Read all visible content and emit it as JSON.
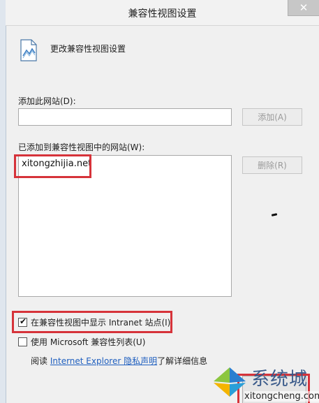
{
  "window": {
    "title": "兼容性视图设置",
    "close_glyph": "✕"
  },
  "header": {
    "icon": "compatibility-document-icon",
    "text": "更改兼容性视图设置"
  },
  "add_site": {
    "label": "添加此网站(D):",
    "value": "",
    "add_button": "添加(A)"
  },
  "added_sites": {
    "label": "已添加到兼容性视图中的网站(W):",
    "items": [
      "xitongzhijia.net"
    ],
    "remove_button": "删除(R)"
  },
  "options": {
    "intranet": {
      "label": "在兼容性视图中显示 Intranet 站点(I)",
      "checked": true
    },
    "ms_list": {
      "label": "使用 Microsoft 兼容性列表(U)",
      "checked": false
    }
  },
  "privacy": {
    "prefix": "阅读",
    "link": "Internet Explorer 隐私声明",
    "suffix": "了解详细信息"
  },
  "watermark": {
    "name": "系统城",
    "url": "xitongcheng.com"
  },
  "colors": {
    "highlight": "#d6333a",
    "link": "#1f5fbf",
    "watermark_blue": "#3a5a8a"
  }
}
